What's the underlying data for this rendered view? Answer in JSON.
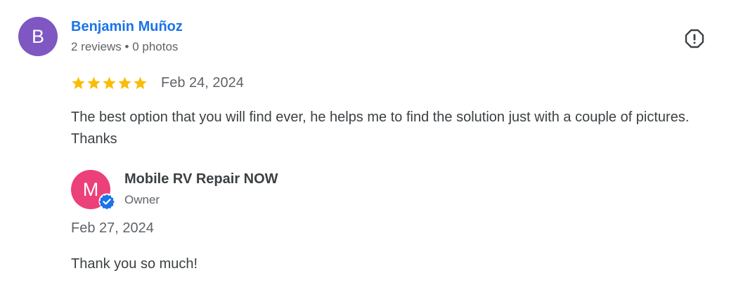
{
  "review": {
    "avatar_letter": "B",
    "avatar_color": "#7e57c2",
    "reviewer_name": "Benjamin Muñoz",
    "reviewer_meta": "2 reviews • 0 photos",
    "rating": 5,
    "rating_max": 5,
    "star_color": "#fbbc04",
    "date": "Feb 24, 2024",
    "text": "The best option that you will find ever, he helps me to find the solution just with a couple of pictures. Thanks",
    "report_icon": "report-flag-icon"
  },
  "owner_reply": {
    "avatar_letter": "M",
    "avatar_color": "#ec407a",
    "name": "Mobile RV Repair NOW",
    "role": "Owner",
    "verified_icon": "verified-badge-icon",
    "verified_color": "#1a73e8",
    "date": "Feb 27, 2024",
    "text": "Thank you so much!"
  },
  "colors": {
    "link": "#1a73e8",
    "secondary_text": "#5f6368",
    "primary_text": "#3c4043"
  }
}
